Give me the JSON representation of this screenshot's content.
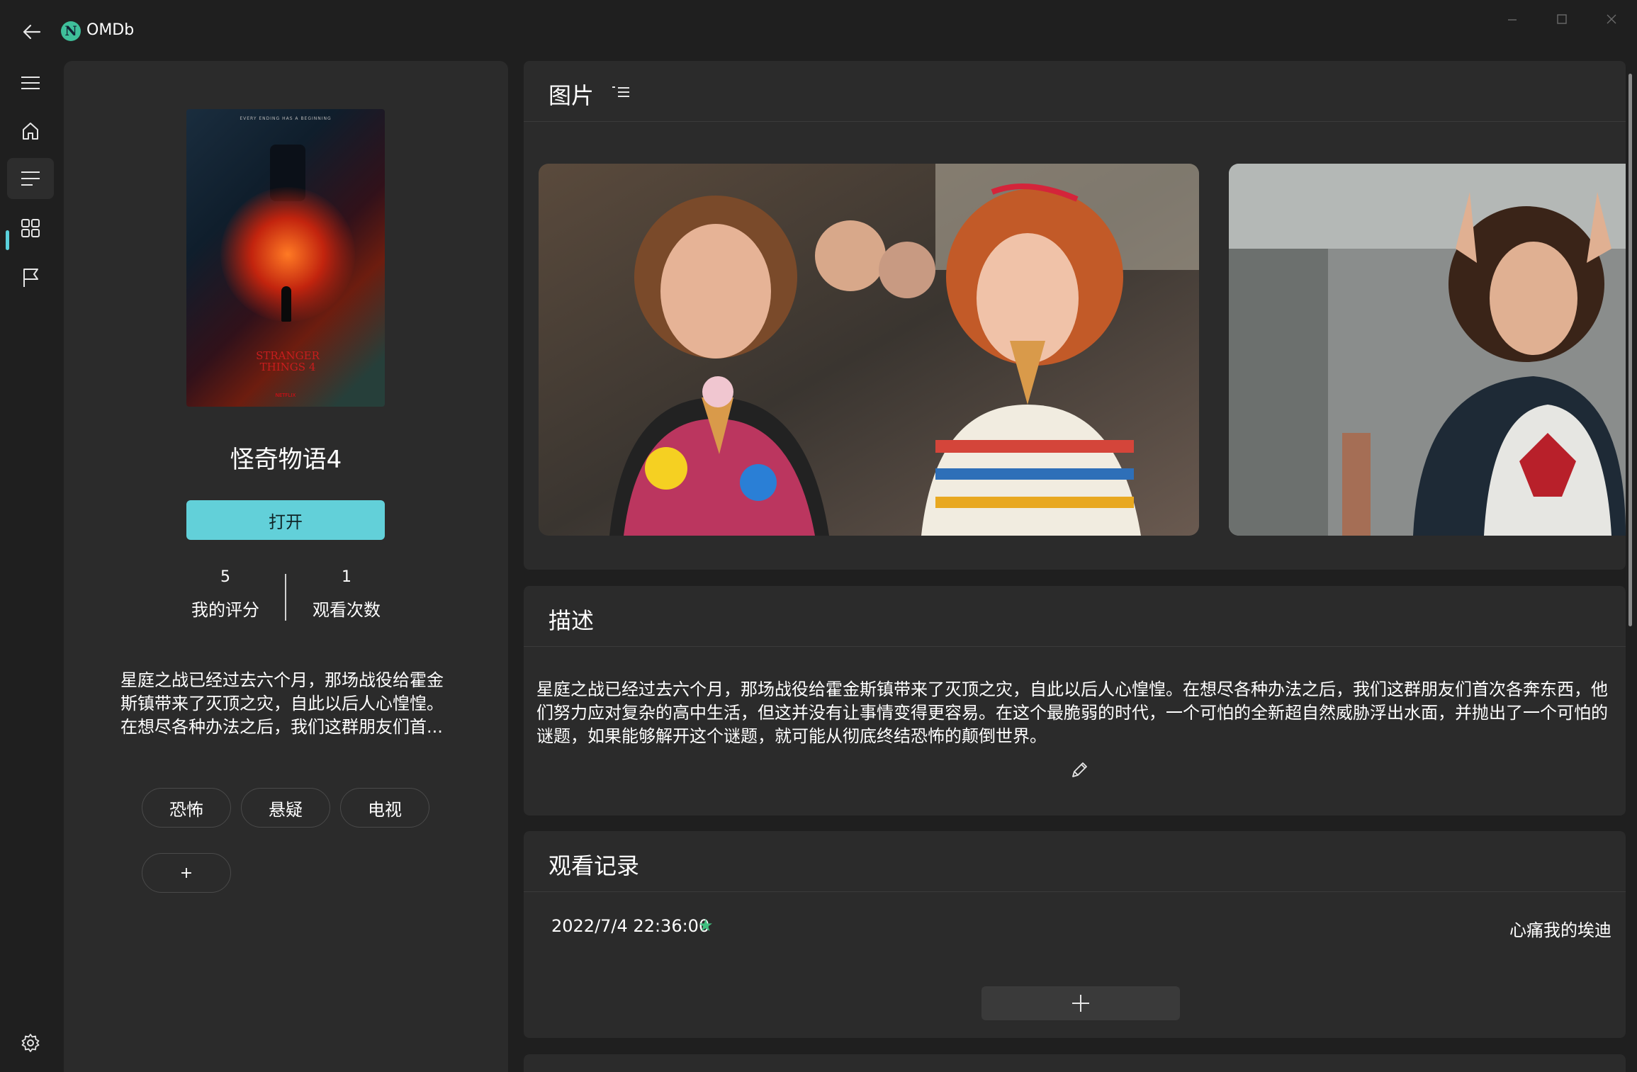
{
  "window": {
    "app_title": "OMDb",
    "logo_letter": "N"
  },
  "nav": {
    "items": [
      "menu-icon",
      "home-icon",
      "list-icon",
      "grid-icon",
      "flag-icon"
    ],
    "settings_icon": "gear-icon",
    "active_color": "#5ad1dc"
  },
  "movie": {
    "title": "怪奇物语4",
    "open_label": "打开",
    "poster": {
      "tagline": "EVERY ENDING HAS A BEGINNING",
      "logo_text": "STRANGER THINGS",
      "season_number": "4",
      "studio": "NETFLIX"
    },
    "stats": [
      {
        "value": "5",
        "label": "我的评分"
      },
      {
        "value": "1",
        "label": "观看次数"
      }
    ],
    "summary": "星庭之战已经过去六个月，那场战役给霍金斯镇带来了灭顶之灾，自此以后人心惶惶。在想尽各种办法之后，我们这群朋友们首...",
    "tags": [
      "恐怖",
      "悬疑",
      "电视"
    ],
    "add_tag_label": "+"
  },
  "images_card": {
    "title": "图片"
  },
  "description_card": {
    "title": "描述",
    "text": "星庭之战已经过去六个月，那场战役给霍金斯镇带来了灭顶之灾，自此以后人心惶惶。在想尽各种办法之后，我们这群朋友们首次各奔东西，他们努力应对复杂的高中生活，但这并没有让事情变得更容易。在这个最脆弱的时代，一个可怕的全新超自然威胁浮出水面，并抛出了一个可怕的谜题，如果能够解开这个谜题，就可能从彻底终结恐怖的颠倒世界。"
  },
  "history_card": {
    "title": "观看记录",
    "entries": [
      {
        "datetime": "2022/7/4 22:36:00",
        "star": "★",
        "note": "心痛我的埃迪"
      }
    ],
    "star_color": "#3fbf7f"
  }
}
